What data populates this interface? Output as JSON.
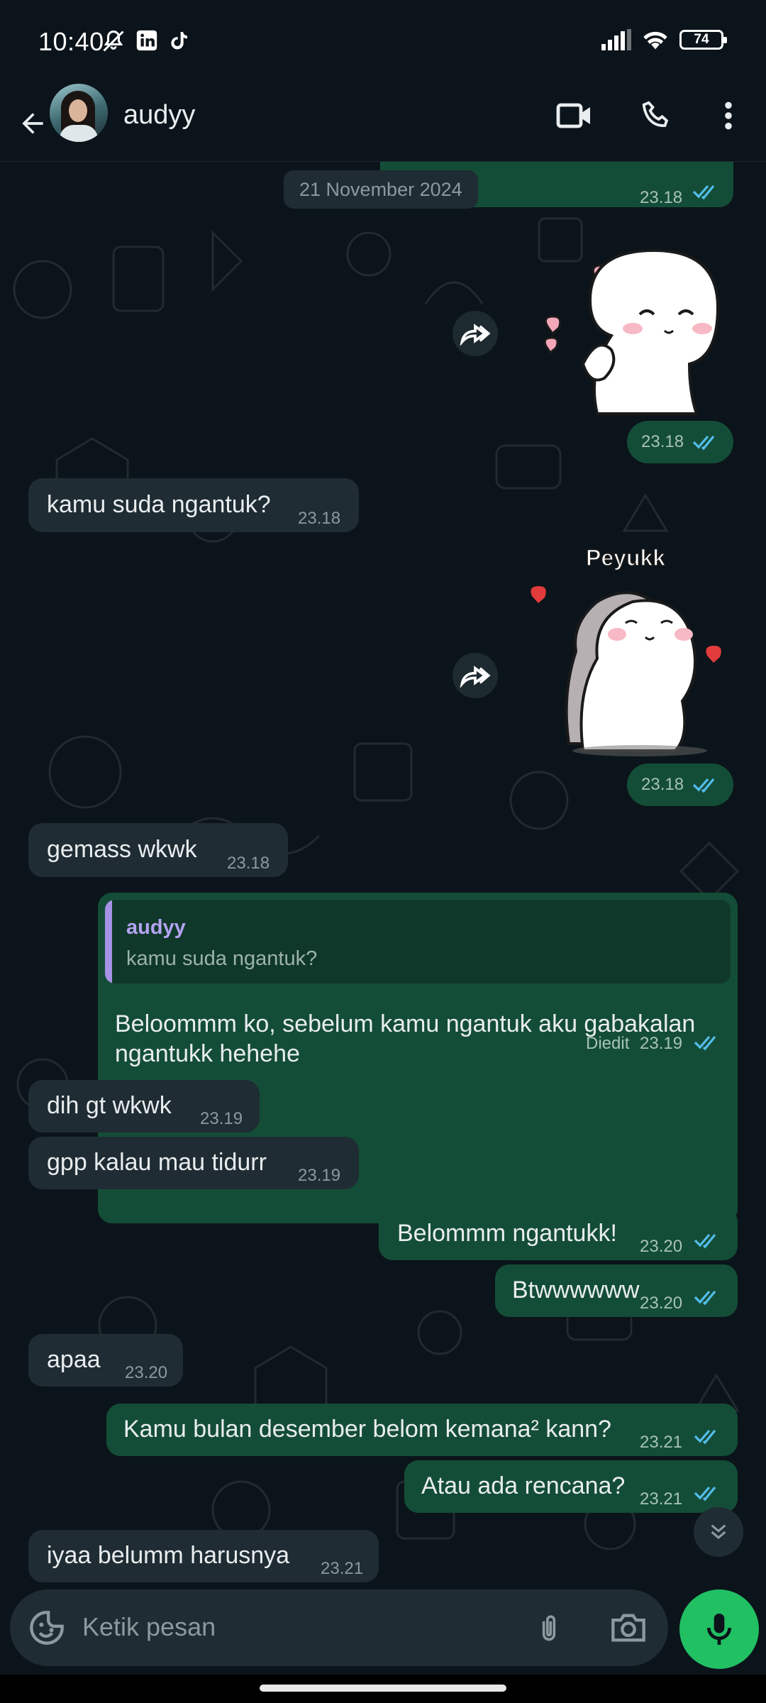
{
  "status_bar": {
    "time": "10:40",
    "battery": "74",
    "icons_left": [
      "mute-notification-icon",
      "linkedin-icon",
      "tiktok-icon"
    ],
    "icons_right": [
      "signal-icon",
      "wifi-icon",
      "battery-icon"
    ]
  },
  "header": {
    "contact_name": "audyy",
    "actions": [
      "video-call-icon",
      "voice-call-icon",
      "more-options-icon"
    ]
  },
  "chat": {
    "top_partial": {
      "time": "23.18"
    },
    "date_chip": "21 November 2024",
    "messages": [
      {
        "type": "sticker",
        "dir": "out",
        "time": "23.18",
        "sticker": "blushing-character-with-hearts"
      },
      {
        "type": "text",
        "dir": "in",
        "text": "kamu suda ngantuk?",
        "time": "23.18"
      },
      {
        "type": "sticker",
        "dir": "out",
        "time": "23.18",
        "sticker": "hugging-cats",
        "sticker_caption": "Peyukk"
      },
      {
        "type": "text",
        "dir": "in",
        "text": "gemass wkwk",
        "time": "23.18"
      },
      {
        "type": "reply",
        "dir": "out",
        "quote_name": "audyy",
        "quote_text": "kamu suda ngantuk?",
        "text_line1": "Beloommm ko, sebelum kamu ngantuk aku gabakalan",
        "text_line2": "ngantukk hehehe",
        "edited": "Diedit",
        "time": "23.19"
      },
      {
        "type": "text",
        "dir": "in",
        "text": "dih gt wkwk",
        "time": "23.19"
      },
      {
        "type": "text",
        "dir": "in",
        "text": "gpp kalau mau tidurr",
        "time": "23.19"
      },
      {
        "type": "text",
        "dir": "out",
        "text": "Belommm ngantukk!",
        "time": "23.20"
      },
      {
        "type": "text",
        "dir": "out",
        "text": "Btwwwwww",
        "time": "23.20"
      },
      {
        "type": "text",
        "dir": "in",
        "text": "apaa",
        "time": "23.20"
      },
      {
        "type": "text",
        "dir": "out",
        "text": "Kamu bulan desember belom kemana² kann?",
        "time": "23.21"
      },
      {
        "type": "text",
        "dir": "out",
        "text": "Atau ada rencana?",
        "time": "23.21"
      },
      {
        "type": "text",
        "dir": "in",
        "text": "iyaa belumm harusnya",
        "time": "23.21"
      }
    ]
  },
  "input": {
    "placeholder": "Ketik pesan",
    "icons": [
      "emoji-icon",
      "attach-icon",
      "camera-icon",
      "mic-icon"
    ]
  },
  "colors": {
    "background": "#0b141a",
    "incoming_bubble": "#1f2c33",
    "outgoing_bubble": "#144d37",
    "read_ticks": "#53bdeb",
    "mic_button": "#21c063"
  }
}
